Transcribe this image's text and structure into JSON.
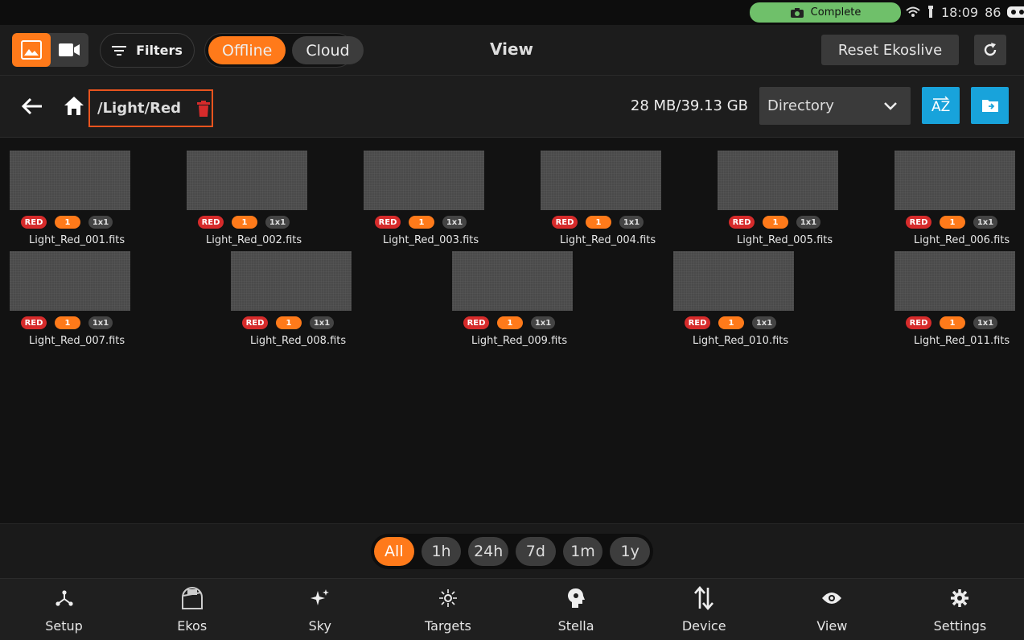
{
  "status_bar": {
    "pill_label": "Complete",
    "time": "18:09",
    "battery": "86",
    "pill_color": "#6fc06a"
  },
  "top_bar": {
    "image_mode_icon": "image-icon",
    "video_mode_icon": "video-icon",
    "filters_label": "Filters",
    "offline_label": "Offline",
    "cloud_label": "Cloud",
    "title": "View",
    "reset_label": "Reset Ekoslive",
    "refresh_icon": "refresh-icon"
  },
  "path_bar": {
    "path": "/Light/Red",
    "storage": "28 MB/39.13 GB",
    "sort_select_value": "Directory",
    "sort_icon": "sort-az-icon",
    "folder_icon": "folder-icon"
  },
  "files": [
    {
      "name": "Light_Red_001.fits",
      "filter": "RED",
      "count": "1",
      "binning": "1x1"
    },
    {
      "name": "Light_Red_002.fits",
      "filter": "RED",
      "count": "1",
      "binning": "1x1"
    },
    {
      "name": "Light_Red_003.fits",
      "filter": "RED",
      "count": "1",
      "binning": "1x1"
    },
    {
      "name": "Light_Red_004.fits",
      "filter": "RED",
      "count": "1",
      "binning": "1x1"
    },
    {
      "name": "Light_Red_005.fits",
      "filter": "RED",
      "count": "1",
      "binning": "1x1"
    },
    {
      "name": "Light_Red_006.fits",
      "filter": "RED",
      "count": "1",
      "binning": "1x1"
    },
    {
      "name": "Light_Red_007.fits",
      "filter": "RED",
      "count": "1",
      "binning": "1x1"
    },
    {
      "name": "Light_Red_008.fits",
      "filter": "RED",
      "count": "1",
      "binning": "1x1"
    },
    {
      "name": "Light_Red_009.fits",
      "filter": "RED",
      "count": "1",
      "binning": "1x1"
    },
    {
      "name": "Light_Red_010.fits",
      "filter": "RED",
      "count": "1",
      "binning": "1x1"
    },
    {
      "name": "Light_Red_011.fits",
      "filter": "RED",
      "count": "1",
      "binning": "1x1"
    }
  ],
  "time_filter": {
    "options": [
      "All",
      "1h",
      "24h",
      "7d",
      "1m",
      "1y"
    ],
    "selected": "All"
  },
  "nav": [
    {
      "label": "Setup",
      "icon": "setup-icon"
    },
    {
      "label": "Ekos",
      "icon": "ekos-icon"
    },
    {
      "label": "Sky",
      "icon": "sky-icon"
    },
    {
      "label": "Targets",
      "icon": "targets-icon"
    },
    {
      "label": "Stella",
      "icon": "stella-icon"
    },
    {
      "label": "Device",
      "icon": "device-icon"
    },
    {
      "label": "View",
      "icon": "view-icon"
    },
    {
      "label": "Settings",
      "icon": "settings-icon"
    }
  ],
  "colors": {
    "accent": "#ff7a1a",
    "blue": "#18a3db",
    "red_badge": "#d62b2b",
    "path_border": "#e8541e"
  }
}
